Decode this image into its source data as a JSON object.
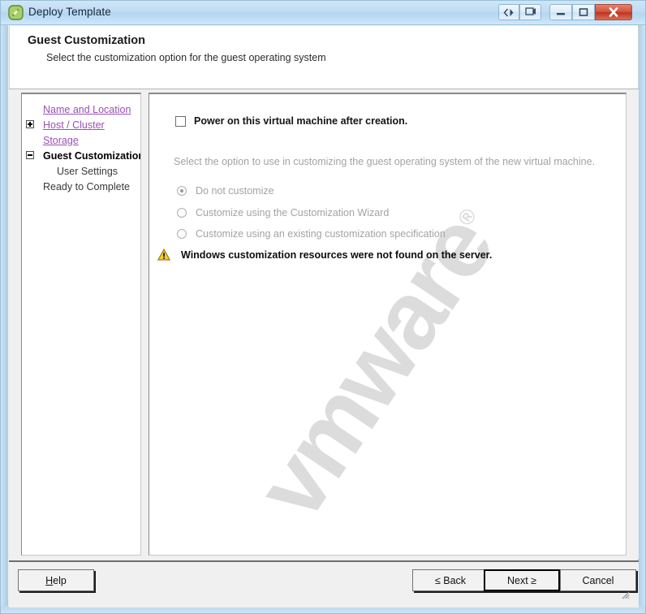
{
  "window": {
    "title": "Deploy Template",
    "icon": "deploy-template-icon",
    "titlebar_buttons": {
      "nav_back_forward": "navigate-icon",
      "screen": "screen-icon",
      "minimize": "minimize-icon",
      "maximize": "maximize-icon",
      "close": "close-icon"
    },
    "colors": {
      "titlebar_top": "#cfe6f7",
      "titlebar_bottom": "#cfe7fa",
      "frame": "#a8cde6",
      "close_button": "#d3523c",
      "link": "#9b4fb5",
      "disabled_text": "#a3a3a3",
      "warning": "#f2c218"
    }
  },
  "header": {
    "title": "Guest Customization",
    "subtitle": "Select the customization option for the guest operating system"
  },
  "sidebar": {
    "items": [
      {
        "label": "Name and Location",
        "style": "link",
        "toggle": null,
        "indent": 26
      },
      {
        "label": "Host / Cluster",
        "style": "link",
        "toggle": "plus",
        "indent": 26
      },
      {
        "label": "Storage",
        "style": "link",
        "toggle": null,
        "indent": 26
      },
      {
        "label": "Guest Customization",
        "style": "current",
        "toggle": "minus",
        "indent": 26
      },
      {
        "label": "User Settings",
        "style": "plain",
        "indent": 43
      },
      {
        "label": "Ready to Complete",
        "style": "plain",
        "indent": 26
      }
    ]
  },
  "content": {
    "watermark": "vmware",
    "watermark_mark": "®",
    "power_on": {
      "label": "Power on this virtual machine after creation.",
      "checked": false
    },
    "description": "Select the option to use in customizing the guest operating system of the new virtual machine.",
    "options": [
      {
        "label": "Do not customize",
        "selected": true,
        "disabled": true
      },
      {
        "label": "Customize using the Customization Wizard",
        "selected": false,
        "disabled": true
      },
      {
        "label": "Customize using an existing customization specification",
        "selected": false,
        "disabled": true
      }
    ],
    "warning": {
      "icon": "warning-triangle-icon",
      "text": "Windows customization resources were not found on the server."
    }
  },
  "footer": {
    "help": {
      "label": "Help",
      "accel": "H"
    },
    "back": {
      "label": "≤ Back"
    },
    "next": {
      "label": "Next ≥",
      "default": true
    },
    "cancel": {
      "label": "Cancel"
    }
  }
}
